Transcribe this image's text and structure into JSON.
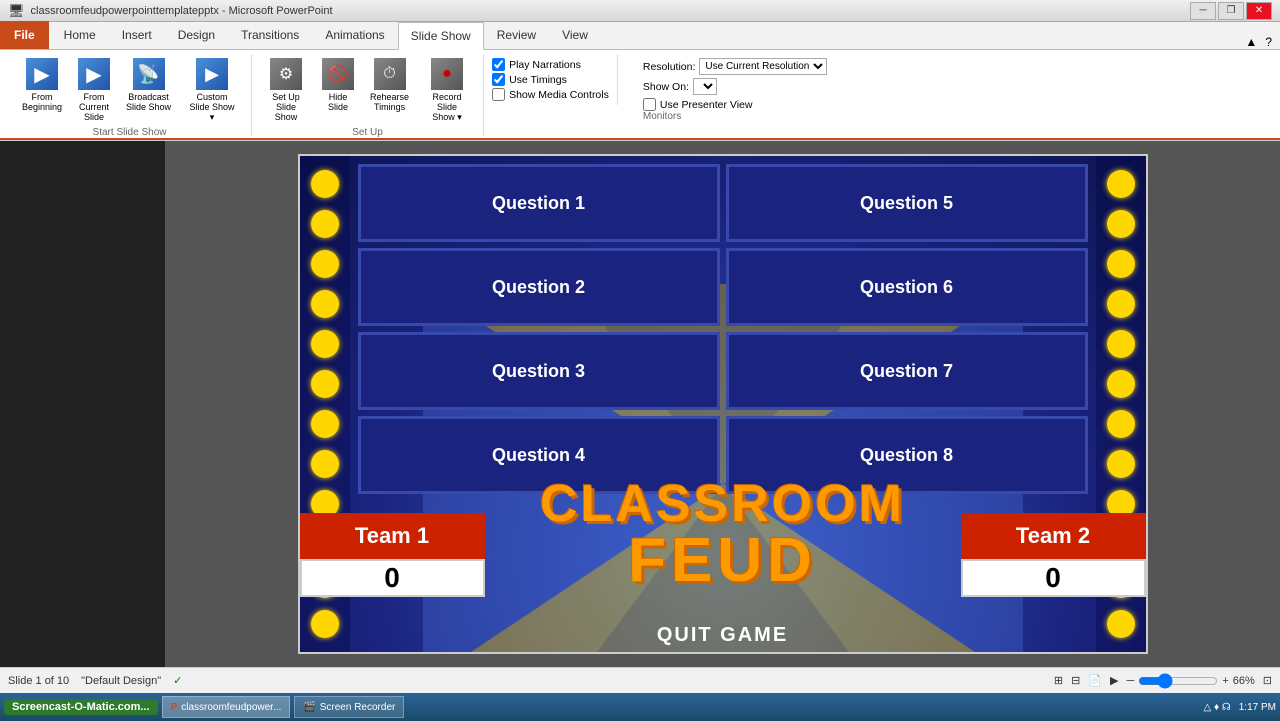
{
  "titleBar": {
    "title": "classroomfeudpowerpointtemplatepptx - Microsoft PowerPoint",
    "minimizeIcon": "─",
    "restoreIcon": "❐",
    "closeIcon": "✕"
  },
  "ribbon": {
    "tabs": [
      {
        "label": "File",
        "active": false
      },
      {
        "label": "Home",
        "active": false
      },
      {
        "label": "Insert",
        "active": false
      },
      {
        "label": "Design",
        "active": false
      },
      {
        "label": "Transitions",
        "active": false
      },
      {
        "label": "Animations",
        "active": false
      },
      {
        "label": "Slide Show",
        "active": true
      },
      {
        "label": "Review",
        "active": false
      },
      {
        "label": "View",
        "active": false
      }
    ],
    "groups": {
      "startSlideShow": {
        "label": "Start Slide Show",
        "buttons": [
          {
            "label": "From Beginning",
            "icon": "▶"
          },
          {
            "label": "From Current Slide",
            "icon": "▶"
          },
          {
            "label": "Broadcast Slide Show",
            "icon": "📡"
          },
          {
            "label": "Custom Slide Show",
            "icon": "▶"
          }
        ]
      },
      "setUp": {
        "label": "Set Up",
        "buttons": [
          {
            "label": "Set Up Slide Show",
            "icon": "⚙"
          },
          {
            "label": "Hide Slide",
            "icon": "🚫"
          },
          {
            "label": "Rehearse Timings",
            "icon": "⏱"
          },
          {
            "label": "Record Slide Show",
            "icon": "●"
          }
        ]
      },
      "checkboxes": [
        {
          "label": "Play Narrations",
          "checked": true
        },
        {
          "label": "Use Timings",
          "checked": true
        },
        {
          "label": "Show Media Controls",
          "checked": false
        }
      ],
      "monitors": {
        "label": "Monitors",
        "resolution": "Use Current Resolution",
        "showOn": "",
        "presenterView": false
      }
    }
  },
  "slide": {
    "questions": [
      {
        "label": "Question 1"
      },
      {
        "label": "Question 5"
      },
      {
        "label": "Question 2"
      },
      {
        "label": "Question 6"
      },
      {
        "label": "Question 3"
      },
      {
        "label": "Question 7"
      },
      {
        "label": "Question 4"
      },
      {
        "label": "Question 8"
      }
    ],
    "classroomText": "CLASSROOM",
    "feudText": "FEUD",
    "team1": {
      "name": "Team 1",
      "score": "0"
    },
    "team2": {
      "name": "Team 2",
      "score": "0"
    },
    "quitGame": "QUIT GAME"
  },
  "statusBar": {
    "slideInfo": "Slide 1 of 10",
    "theme": "\"Default Design\"",
    "checkIcon": "✓",
    "zoom": "66%",
    "fitIcon": "⊡"
  },
  "taskbar": {
    "startLabel": "Screencast-O-Matic.com...",
    "items": [
      {
        "label": "classroomfeudpower...",
        "icon": "P"
      },
      {
        "label": "Screen Recorder",
        "icon": "🎬"
      }
    ],
    "time": "1:17 PM"
  }
}
